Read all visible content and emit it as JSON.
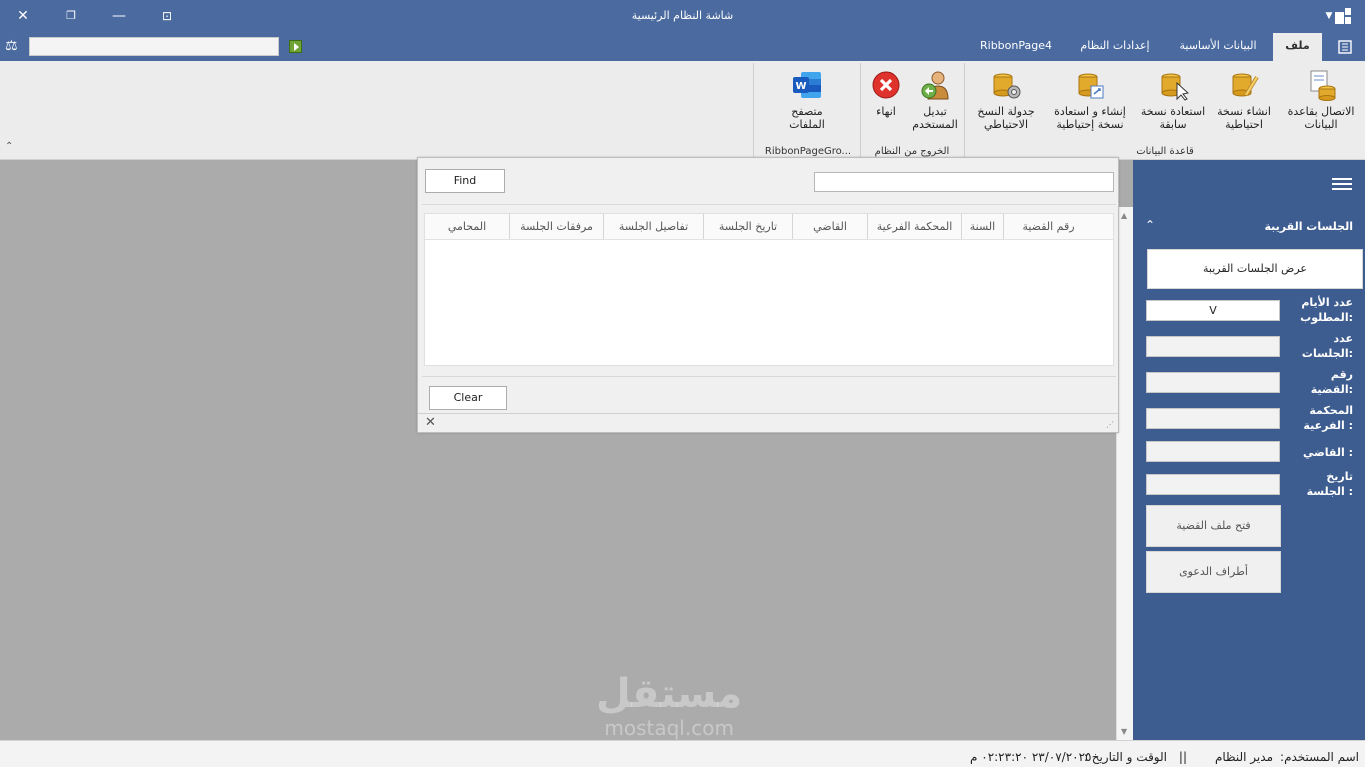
{
  "window": {
    "title": "شاشة النظام الرئيسية"
  },
  "tabs": [
    {
      "label": "ملف",
      "active": true
    },
    {
      "label": "البيانات الأساسية",
      "active": false
    },
    {
      "label": "إعدادات النظام",
      "active": false
    },
    {
      "label": "RibbonPage4",
      "active": false
    }
  ],
  "ribbon": {
    "groups": [
      {
        "label": "قاعدة البيانات",
        "buttons": [
          {
            "label": "الاتصال بقاعدة البيانات",
            "icon": "database-connect-icon"
          },
          {
            "label": "انشاء نسخة احتياطية",
            "icon": "database-backup-icon"
          },
          {
            "label": "استعادة نسخة سابقة",
            "icon": "database-restore-icon"
          },
          {
            "label": "إنشاء و استعادة نسخة إحتياطية",
            "icon": "database-sync-icon"
          },
          {
            "label": "جدولة النسخ الاحتياطي",
            "icon": "database-schedule-icon"
          }
        ]
      },
      {
        "label": "الخروج من النظام",
        "buttons": [
          {
            "label": "تبديل المستخدم",
            "icon": "switch-user-icon"
          },
          {
            "label": "انهاء",
            "icon": "exit-icon"
          }
        ]
      },
      {
        "label": "RibbonPageGro...",
        "buttons": [
          {
            "label": "متصفح الملفات",
            "icon": "word-icon"
          }
        ]
      }
    ]
  },
  "side_panel": {
    "header": "الجلسات القريبة",
    "show_button": "عرض الجلسات القريبة",
    "fields": [
      {
        "label": "عدد الأيام المطلوب:",
        "value": "V"
      },
      {
        "label": "عدد الجلسات:",
        "value": ""
      },
      {
        "label": "رقم القضية:",
        "value": ""
      },
      {
        "label": "المحكمة الفرعية :",
        "value": ""
      },
      {
        "label": "القاضي :",
        "value": ""
      },
      {
        "label": "تاريخ الجلسة :",
        "value": ""
      }
    ],
    "open_case_button": "فتح ملف القضية",
    "parties_button": "أطراف الدعوى"
  },
  "find_dialog": {
    "find_label": "Find",
    "clear_label": "Clear",
    "search_value": "",
    "columns": [
      "رقم القضية",
      "السنة",
      "المحكمة الفرعية",
      "القاضي",
      "تاريخ الجلسة",
      "تفاصيل الجلسة",
      "مرفقات الجلسة",
      "المحامي"
    ]
  },
  "status_bar": {
    "user_label": "اسم المستخدم:",
    "user_value": "مدير النظام",
    "separator": "||",
    "datetime_label": "الوقت و التاريخ :",
    "datetime_value": "٢٣/٠٧/٢٠٢٥ ٠٢:٢٣:٢٠ م"
  },
  "watermark": {
    "arabic": "مستقل",
    "latin": "mostaql.com"
  },
  "colors": {
    "title_bar": "#4a6aa0",
    "side_panel": "#3d5c8f",
    "workspace": "#ababab",
    "ribbon": "#ececec"
  }
}
